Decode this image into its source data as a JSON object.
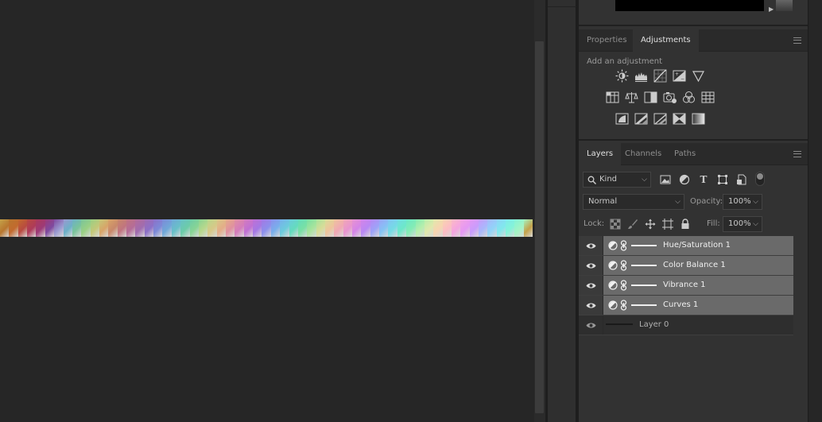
{
  "colors": {
    "panel_bg": "#323232",
    "canvas_bg": "#262626",
    "selected_layer": "#6a6a6a"
  },
  "gradient_strip": {
    "colors": [
      "#c4a24a",
      "#b8762e",
      "#c26a2e",
      "#b84a40",
      "#ae3a5a",
      "#9c3a78",
      "#7e4aa0",
      "#9a9ad0",
      "#6cb0c8",
      "#7ac49a",
      "#9ad084",
      "#c4c878",
      "#d8a468",
      "#c8886a",
      "#c07480",
      "#b46c98",
      "#a06cb0",
      "#8c70c8",
      "#7c8ad8",
      "#70a8d8",
      "#68c0c8",
      "#6ccca8",
      "#88d494",
      "#b8d88c",
      "#d8c888",
      "#e4ac88",
      "#e090a0",
      "#d47cbc",
      "#c070d4",
      "#a478e4",
      "#8c90ec",
      "#78b0ec",
      "#6cccdc",
      "#64dcbc",
      "#78e0a4",
      "#a8e49c",
      "#d8dc98",
      "#eec49c",
      "#f0a8b4",
      "#e894d0",
      "#d484e8",
      "#b888f4",
      "#9ca4f8",
      "#84c4f4",
      "#74dce4",
      "#6ce8c8",
      "#84ecb4",
      "#b8eeac",
      "#e0e8ac",
      "#f8d4b0",
      "#fcbcc4",
      "#f4a4e0",
      "#e498f4",
      "#c89cfc",
      "#a8b8fc",
      "#90d4f8",
      "#80e8ec",
      "#84f4d8",
      "#a4f4c4"
    ]
  },
  "adjustments": {
    "tabs": [
      "Properties",
      "Adjustments"
    ],
    "active_tab": "Adjustments",
    "hint": "Add an adjustment",
    "row1": [
      "brightness-contrast-icon",
      "levels-icon",
      "curves-icon",
      "exposure-icon",
      "vibrance-icon"
    ],
    "row2": [
      "hue-saturation-icon",
      "color-balance-icon",
      "black-white-icon",
      "photo-filter-icon",
      "channel-mixer-icon",
      "color-lookup-icon"
    ],
    "row3": [
      "invert-icon",
      "posterize-icon",
      "threshold-icon",
      "selective-color-icon",
      "gradient-map-icon"
    ]
  },
  "layers_panel": {
    "tabs": [
      "Layers",
      "Channels",
      "Paths"
    ],
    "active_tab": "Layers",
    "filter_kind": "Kind",
    "blend_mode": "Normal",
    "opacity_label": "Opacity:",
    "opacity_value": "100%",
    "lock_label": "Lock:",
    "fill_label": "Fill:",
    "fill_value": "100%",
    "layers": [
      {
        "name": "Hue/Saturation 1",
        "type": "adjustment",
        "selected": true
      },
      {
        "name": "Color Balance 1",
        "type": "adjustment",
        "selected": true
      },
      {
        "name": "Vibrance 1",
        "type": "adjustment",
        "selected": true
      },
      {
        "name": "Curves 1",
        "type": "adjustment",
        "selected": true
      },
      {
        "name": "Layer 0",
        "type": "pixel",
        "selected": false
      }
    ]
  }
}
